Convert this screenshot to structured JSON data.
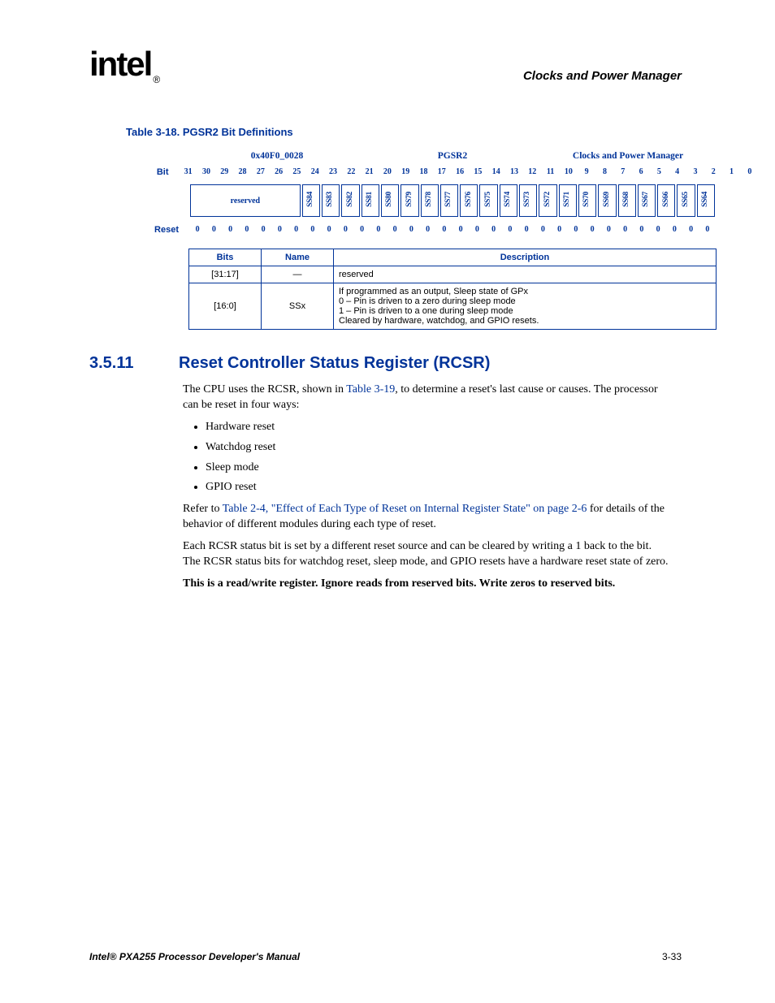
{
  "header": {
    "section": "Clocks and Power Manager",
    "logo": "intel",
    "logo_r": "®"
  },
  "table18": {
    "caption": "Table 3-18. PGSR2 Bit Definitions",
    "address": "0x40F0_0028",
    "regname": "PGSR2",
    "module": "Clocks and Power Manager",
    "bit_label": "Bit",
    "reset_label": "Reset",
    "reserved": "reserved",
    "bits": [
      "31",
      "30",
      "29",
      "28",
      "27",
      "26",
      "25",
      "24",
      "23",
      "22",
      "21",
      "20",
      "19",
      "18",
      "17",
      "16",
      "15",
      "14",
      "13",
      "12",
      "11",
      "10",
      "9",
      "8",
      "7",
      "6",
      "5",
      "4",
      "3",
      "2",
      "1",
      "0"
    ],
    "fields": [
      "SS84",
      "SS83",
      "SS82",
      "SS81",
      "SS80",
      "SS79",
      "SS78",
      "SS77",
      "SS76",
      "SS75",
      "SS74",
      "SS73",
      "SS72",
      "SS71",
      "SS70",
      "SS69",
      "SS68",
      "SS67",
      "SS66",
      "SS65",
      "SS64"
    ],
    "resets": [
      "0",
      "0",
      "0",
      "0",
      "0",
      "0",
      "0",
      "0",
      "0",
      "0",
      "0",
      "0",
      "0",
      "0",
      "0",
      "0",
      "0",
      "0",
      "0",
      "0",
      "0",
      "0",
      "0",
      "0",
      "0",
      "0",
      "0",
      "0",
      "0",
      "0",
      "0",
      "0"
    ],
    "cols": {
      "bits": "Bits",
      "name": "Name",
      "desc": "Description"
    },
    "row1": {
      "bits": "[31:17]",
      "name": "—",
      "desc": "reserved"
    },
    "row2": {
      "bits": "[16:0]",
      "name": "SSx",
      "desc1": "If programmed as an output, Sleep state of GPx",
      "desc2": "0 –   Pin is driven to a zero during sleep mode",
      "desc3": "1 –   Pin is driven to a one during sleep mode",
      "desc4": "Cleared by hardware, watchdog, and GPIO resets."
    }
  },
  "section": {
    "num": "3.5.11",
    "title": "Reset Controller Status Register (RCSR)",
    "p1a": "The CPU uses the RCSR, shown in ",
    "p1link": "Table 3-19",
    "p1b": ", to determine a reset's last cause or causes. The processor can be reset in four ways:",
    "bullets": [
      "Hardware reset",
      "Watchdog reset",
      "Sleep mode",
      "GPIO reset"
    ],
    "p2a": "Refer to ",
    "p2link": "Table 2-4, \"Effect of Each Type of Reset on Internal Register State\" on page 2-6",
    "p2b": " for details of the behavior of different modules during each type of reset.",
    "p3": "Each RCSR status bit is set by a different reset source and can be cleared by writing a 1 back to the bit. The RCSR status bits for watchdog reset, sleep mode, and GPIO resets have a hardware reset state of zero.",
    "p4": "This is a read/write register. Ignore reads from reserved bits. Write zeros to reserved bits."
  },
  "footer": {
    "left": "Intel® PXA255 Processor Developer's Manual",
    "right": "3-33"
  }
}
